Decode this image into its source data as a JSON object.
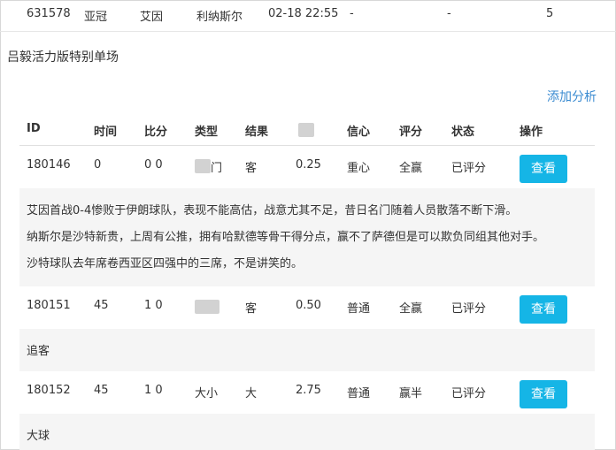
{
  "top": {
    "id": "631578",
    "league": "亚冠",
    "home": "艾因",
    "away": "利纳斯尔",
    "time": "02-18 22:55",
    "dash1": "-",
    "dash2": "-",
    "count": "5"
  },
  "section_title": "吕毅活力版特别单场",
  "add_analysis": "添加分析",
  "headers": [
    "ID",
    "时间",
    "比分",
    "类型",
    "结果",
    "",
    "信心",
    "评分",
    "状态",
    "操作"
  ],
  "rows": [
    {
      "id": "180146",
      "time": "0",
      "score": "0 0",
      "type": "门",
      "result": "客",
      "value": "0.25",
      "confidence": "重心",
      "rating": "全赢",
      "status": "已评分",
      "button": "查看",
      "notes": [
        "艾因首战0-4惨败于伊朗球队，表现不能高估，战意尤其不足，昔日名门随着人员散落不断下滑。",
        "纳斯尔是沙特新贵，上周有公推，拥有哈默德等骨干得分点，赢不了萨德但是可以欺负同组其他对手。",
        "沙特球队去年席卷西亚区四强中的三席，不是讲笑的。"
      ]
    },
    {
      "id": "180151",
      "time": "45",
      "score": "1 0",
      "type": "",
      "result": "客",
      "value": "0.50",
      "confidence": "普通",
      "rating": "全赢",
      "status": "已评分",
      "button": "查看",
      "notes": [
        "追客"
      ]
    },
    {
      "id": "180152",
      "time": "45",
      "score": "1 0",
      "type": "大小",
      "result": "大",
      "value": "2.75",
      "confidence": "普通",
      "rating": "赢半",
      "status": "已评分",
      "button": "查看",
      "notes": [
        "大球"
      ]
    }
  ]
}
